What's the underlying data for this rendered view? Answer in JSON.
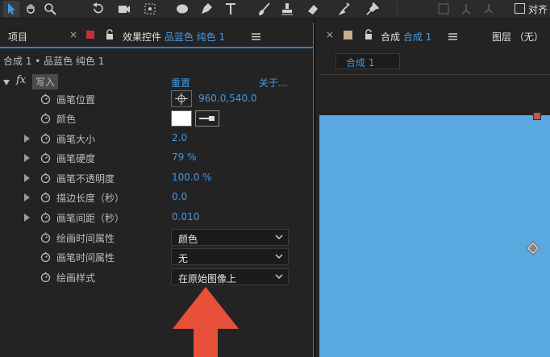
{
  "tabs": {
    "project": "项目",
    "effects_prefix": "效果控件",
    "effects_layer": "品蓝色 纯色 1",
    "composition_prefix": "合成",
    "composition_name": "合成 1",
    "layer": "图层 （无）",
    "comp_subtab": "合成 1",
    "align_checkbox": "对齐"
  },
  "effects": {
    "breadcrumb": "合成 1 • 品蓝色 纯色 1",
    "fx_label": "fx",
    "effect_name": "写入",
    "reset": "重置",
    "about": "关于...",
    "rows": [
      {
        "label": "画笔位置",
        "value": "960.0,540.0"
      },
      {
        "label": "颜色",
        "value": ""
      },
      {
        "label": "画笔大小",
        "value": "2.0"
      },
      {
        "label": "画笔硬度",
        "value": "79 %"
      },
      {
        "label": "画笔不透明度",
        "value": "100.0 %"
      },
      {
        "label": "描边长度（秒）",
        "value": "0.0"
      },
      {
        "label": "画笔间距（秒）",
        "value": "0.010"
      },
      {
        "label": "绘画时间属性",
        "value": "颜色"
      },
      {
        "label": "画笔时间属性",
        "value": "无"
      },
      {
        "label": "绘画样式",
        "value": "在原始图像上"
      }
    ]
  },
  "colors": {
    "accent": "#3f9be8",
    "canvas": "#59a8df",
    "arrow": "#e8503a",
    "swatch": "#ffffff"
  }
}
